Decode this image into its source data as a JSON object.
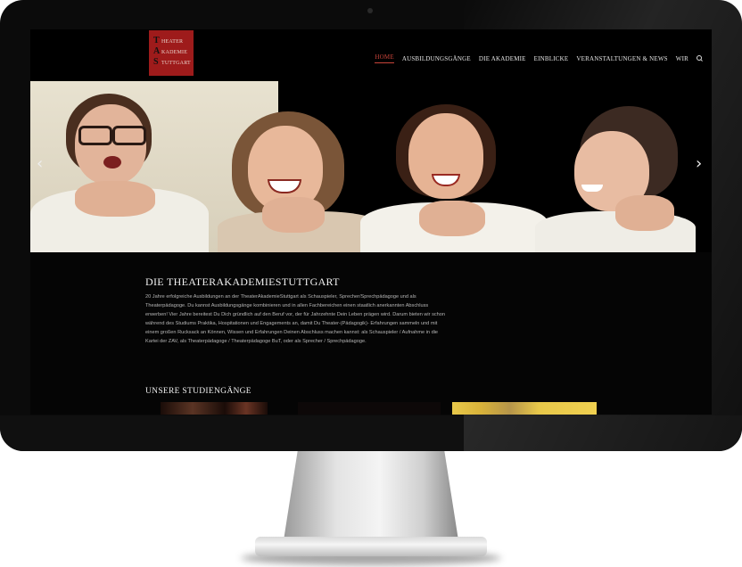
{
  "site": {
    "logo": {
      "letters": [
        "T",
        "A",
        "S"
      ],
      "words": [
        "HEATER",
        "KADEMIE",
        "TUTTGART"
      ]
    },
    "nav": {
      "items": [
        {
          "label": "HOME",
          "active": true
        },
        {
          "label": "AUSBILDUNGSGÄNGE",
          "active": false
        },
        {
          "label": "DIE AKADEMIE",
          "active": false
        },
        {
          "label": "EINBLICKE",
          "active": false
        },
        {
          "label": "VERANSTALTUNGEN & NEWS",
          "active": false
        },
        {
          "label": "WIR",
          "active": false
        }
      ],
      "search_icon": "search-icon"
    },
    "slider": {
      "prev_icon": "chevron-left-icon",
      "next_icon": "chevron-right-icon",
      "prev_glyph": "‹",
      "next_glyph": "›"
    },
    "intro": {
      "title": "DIE THEATERAKADEMIESTUTTGART",
      "body": "20 Jahre erfolgreiche Ausbildungen an der TheaterAkademieStuttgart als Schauspieler, Sprecher/Sprechpädagoge und als Theaterpädagoge. Du kannst Ausbildungsgänge kombinieren und in allen Fachbereichen einen staatlich anerkannten Abschluss erwerben! Vier Jahre bereitest Du Dich gründlich auf den Beruf vor, der für Jahrzehnte Dein Leben prägen wird. Darum bieten wir schon während des Studiums Praktika, Hospitationen und Engagements an, damit Du Theater-(Pädagogik)- Erfahrungen sammeln und mit einem großen Rucksack an Können, Wissen und Erfahrungen Deinen Abschluss machen kannst: als Schauspieler / Aufnahme in die Kartei der ZAV, als Theaterpädagoge / Theaterpädagoge BuT, oder als Sprecher / Sprechpädagoge."
    },
    "studies": {
      "title": "UNSERE STUDIENGÄNGE"
    },
    "colors": {
      "accent": "#c9443a",
      "logo_bg": "#9e1b1b",
      "page_bg": "#050505"
    }
  }
}
